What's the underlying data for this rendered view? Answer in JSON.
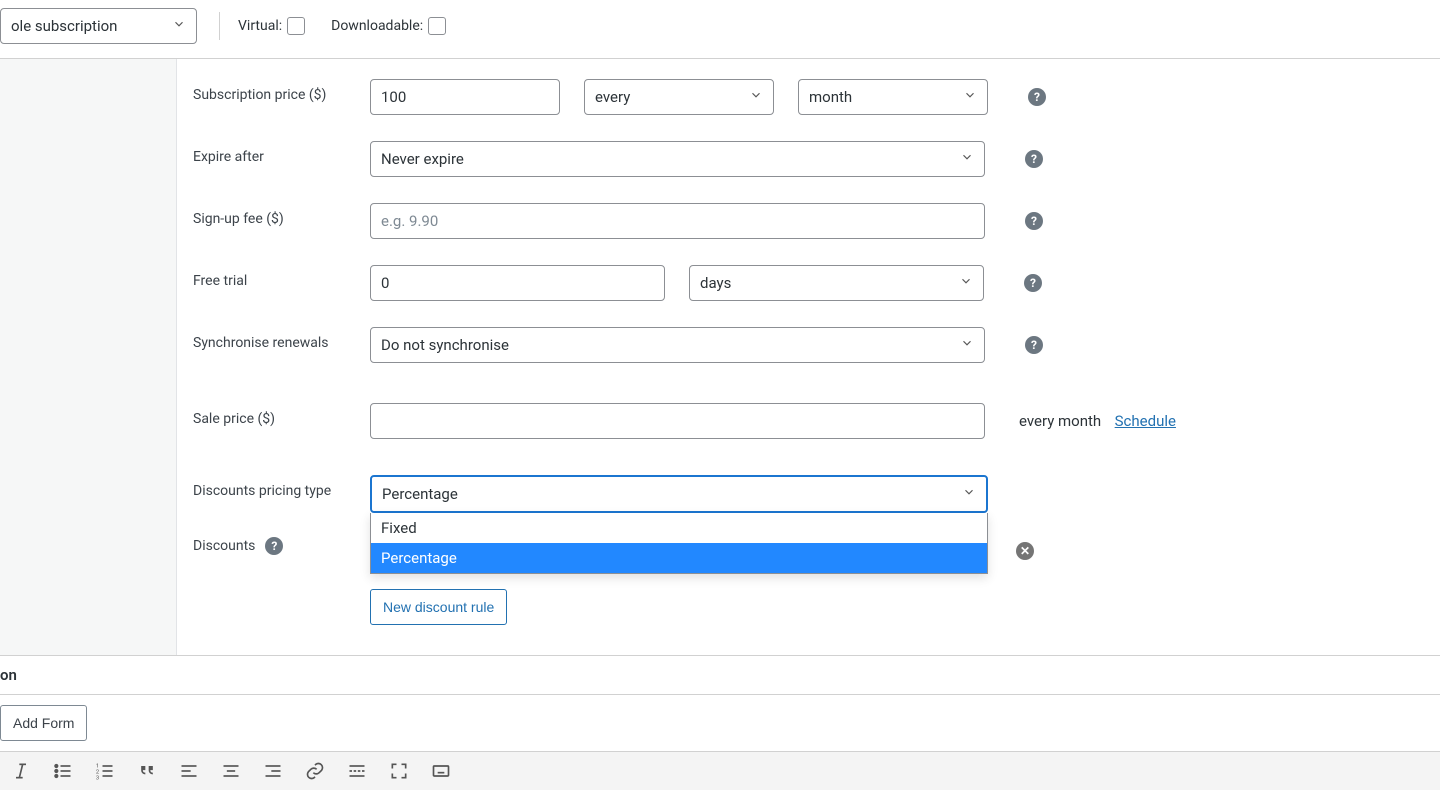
{
  "topbar": {
    "product_type": "ole subscription",
    "virtual_label": "Virtual:",
    "downloadable_label": "Downloadable:"
  },
  "fields": {
    "subscription_price": {
      "label": "Subscription price ($)",
      "value": "100",
      "frequency": "every",
      "period": "month"
    },
    "expire_after": {
      "label": "Expire after",
      "value": "Never expire"
    },
    "signup_fee": {
      "label": "Sign-up fee ($)",
      "placeholder": "e.g. 9.90"
    },
    "free_trial": {
      "label": "Free trial",
      "value": "0",
      "unit": "days"
    },
    "sync": {
      "label": "Synchronise renewals",
      "value": "Do not synchronise"
    },
    "sale": {
      "label": "Sale price ($)",
      "value": "",
      "suffix": "every month",
      "schedule": "Schedule"
    },
    "discount_type": {
      "label": "Discounts pricing type",
      "value": "Percentage",
      "options": [
        "Fixed",
        "Percentage"
      ]
    },
    "discounts": {
      "label": "Discounts",
      "new_rule": "New discount rule"
    }
  },
  "bottom": {
    "title": "on",
    "add_form": "Add Form"
  },
  "icons": {
    "italic": "italic-icon",
    "ul": "bullet-list-icon",
    "ol": "numbered-list-icon",
    "quote": "quote-icon",
    "align_left": "align-left-icon",
    "align_center": "align-center-icon",
    "align_right": "align-right-icon",
    "link": "link-icon",
    "insert": "insert-more-icon",
    "fullscreen": "fullscreen-icon",
    "keyboard": "keyboard-icon"
  }
}
